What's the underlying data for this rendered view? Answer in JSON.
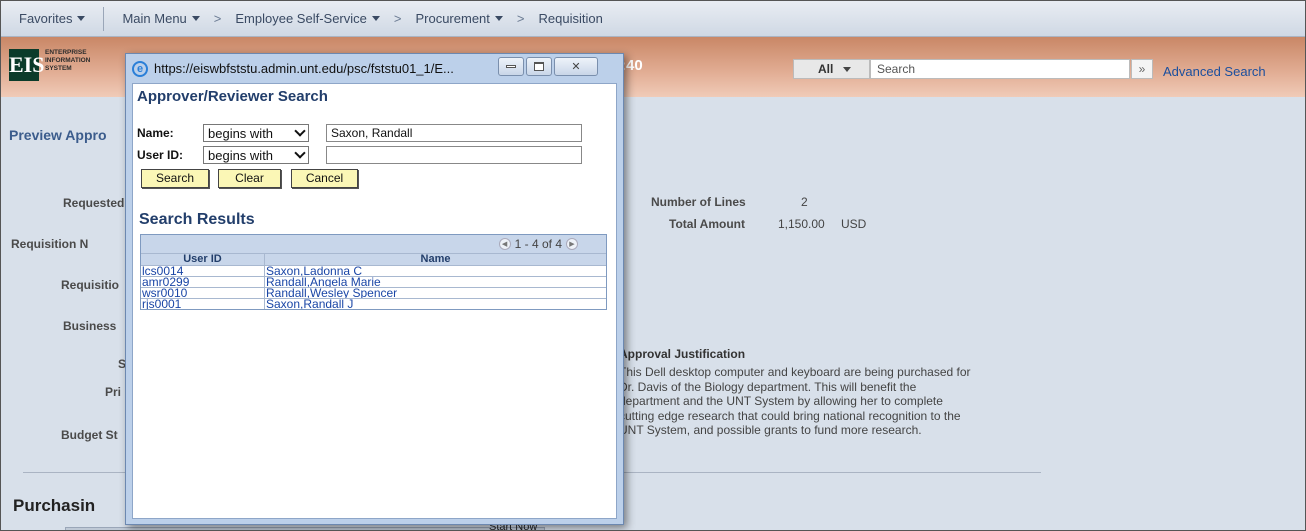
{
  "nav": {
    "favorites": "Favorites",
    "main_menu": "Main Menu",
    "employee_self_service": "Employee Self-Service",
    "procurement": "Procurement",
    "requisition": "Requisition",
    "separator": ">"
  },
  "header": {
    "logo_mark": "EIS",
    "logo_line1": "ENTERPRISE",
    "logo_line2": "INFORMATION",
    "logo_line3": "SYSTEM",
    "time_fragment": ":40",
    "search_scope": "All",
    "search_placeholder": "Search",
    "search_go": "»",
    "advanced_search": "Advanced Search"
  },
  "page": {
    "title": "Preview Appro",
    "labels": {
      "requested": "Requested",
      "requisition_n": "Requisition N",
      "requisition": "Requisitio",
      "business": "Business",
      "s": "S",
      "pri": "Pri",
      "budget": "Budget St"
    },
    "number_of_lines_label": "Number of Lines",
    "number_of_lines_value": "2",
    "total_amount_label": "Total Amount",
    "total_amount_value": "1,150.00",
    "total_amount_currency": "USD",
    "justification_title": "Approval Justification",
    "justification_text": "This Dell desktop computer and keyboard are being purchased for Dr. Davis of the Biology department. This will benefit the department and the UNT System by allowing her to complete cutting edge research that could bring national recognition to the UNT System, and possible grants to fund more research.",
    "purchasing": "Purchasin",
    "start_now": "Start Now"
  },
  "popup": {
    "url": "https://eiswbfststu.admin.unt.edu/psc/fststu01_1/E...",
    "title": "Approver/Reviewer Search",
    "name_label": "Name:",
    "name_operator": "begins with",
    "name_value": "Saxon, Randall",
    "userid_label": "User ID:",
    "userid_operator": "begins with",
    "userid_value": "",
    "buttons": {
      "search": "Search",
      "clear": "Clear",
      "cancel": "Cancel"
    },
    "results_title": "Search Results",
    "pagination": "1 - 4 of 4",
    "columns": {
      "user_id": "User ID",
      "name": "Name"
    },
    "rows": [
      {
        "user_id": "lcs0014",
        "name": "Saxon,Ladonna C"
      },
      {
        "user_id": "amr0299",
        "name": "Randall,Angela Marie"
      },
      {
        "user_id": "wsr0010",
        "name": "Randall,Wesley Spencer"
      },
      {
        "user_id": "rjs0001",
        "name": "Saxon,Randall J"
      }
    ]
  }
}
